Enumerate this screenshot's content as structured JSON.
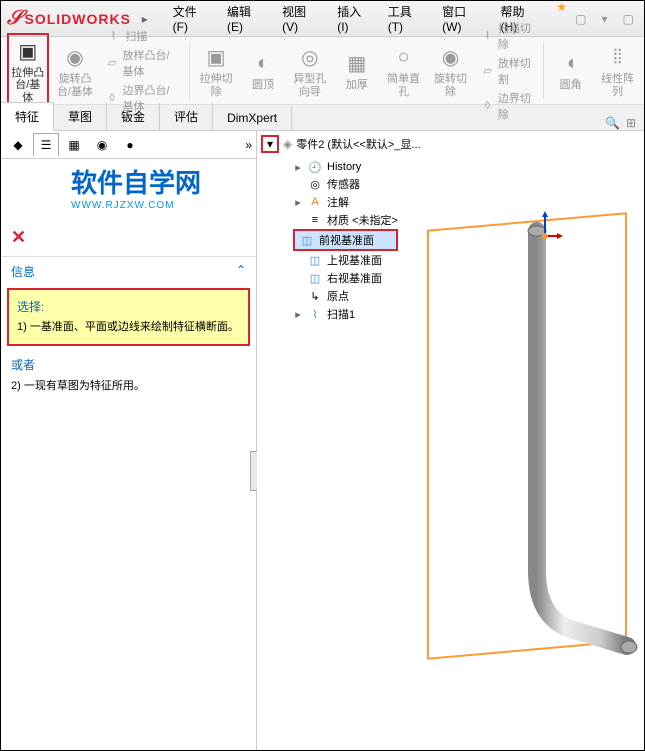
{
  "app": {
    "name": "SOLIDWORKS"
  },
  "menu": {
    "file": "文件(F)",
    "edit": "编辑(E)",
    "view": "视图(V)",
    "insert": "插入(I)",
    "tools": "工具(T)",
    "window": "窗口(W)",
    "help": "帮助(H)"
  },
  "ribbon": {
    "extrude": "拉伸凸台/基体",
    "revolve": "旋转凸台/基体",
    "sweep": "扫描",
    "loft": "放样凸台/基体",
    "boundary": "边界凸台/基体",
    "cut_extrude": "拉伸切除",
    "fillet": "圆顶",
    "hole": "异型孔向导",
    "thicken": "加厚",
    "simple_hole": "简单直孔",
    "revolve_cut": "旋转切除",
    "sweep_cut": "扫描切除",
    "loft_cut": "放样切割",
    "boundary_cut": "边界切除",
    "round": "圆角",
    "linear_pattern": "线性阵列"
  },
  "tabs": {
    "feature": "特征",
    "sketch": "草图",
    "sheetmetal": "钣金",
    "evaluate": "评估",
    "dimxpert": "DimXpert"
  },
  "panel": {
    "info_title": "信息",
    "select_label": "选择:",
    "select_text": "1) 一基准面、平面或边线来绘制特征横断面。",
    "or_label": "或者",
    "alt_text": "2) 一现有草图为特征所用。"
  },
  "watermark": {
    "main": "软件自学网",
    "sub": "WWW.RJZXW.COM"
  },
  "tree": {
    "root": "零件2  (默认<<默认>_显...",
    "history": "History",
    "sensors": "传感器",
    "annotations": "注解",
    "material": "材质 <未指定>",
    "front_plane": "前视基准面",
    "top_plane": "上视基准面",
    "right_plane": "右视基准面",
    "origin": "原点",
    "sweep1": "扫描1"
  }
}
